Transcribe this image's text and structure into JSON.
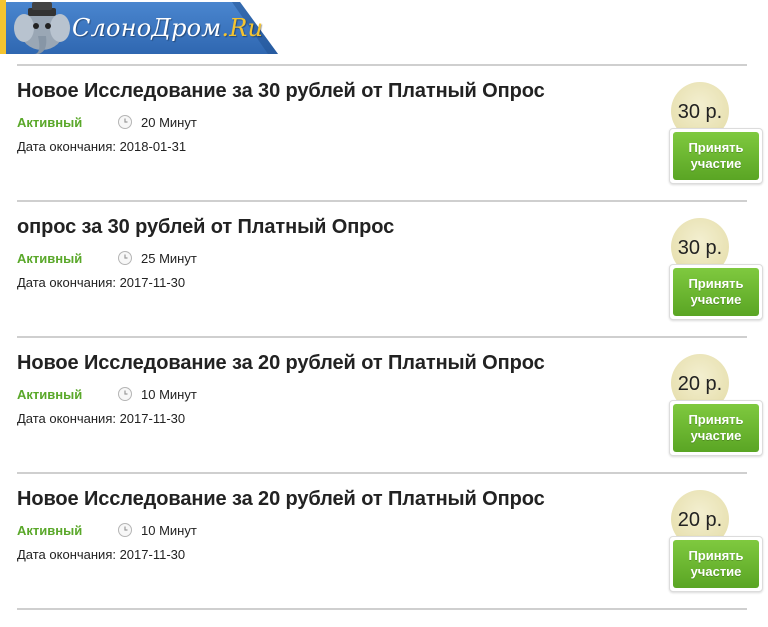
{
  "header": {
    "logo_main": "СлоноДром",
    "logo_suffix": ".Ru"
  },
  "colors": {
    "status_green": "#5aa82a",
    "button_green": "#6bb82f",
    "banner_blue": "#2f67b1",
    "banner_accent_yellow": "#f4c430",
    "badge_beige": "#e8e1b2"
  },
  "icons": {
    "logo": "elephant-mascot-icon",
    "duration": "clock-icon"
  },
  "surveys": [
    {
      "title": "Новое Исследование за 30 рублей от Платный Опрос",
      "status": "Активный",
      "duration": "20 Минут",
      "end_date": "Дата окончания: 2018-01-31",
      "price": "30 р.",
      "button": "Принять участие"
    },
    {
      "title": "опрос за 30 рублей от Платный Опрос",
      "status": "Активный",
      "duration": "25 Минут",
      "end_date": "Дата окончания: 2017-11-30",
      "price": "30 р.",
      "button": "Принять участие"
    },
    {
      "title": "Новое Исследование за 20 рублей от Платный Опрос",
      "status": "Активный",
      "duration": "10 Минут",
      "end_date": "Дата окончания: 2017-11-30",
      "price": "20 р.",
      "button": "Принять участие"
    },
    {
      "title": "Новое Исследование за 20 рублей от Платный Опрос",
      "status": "Активный",
      "duration": "10 Минут",
      "end_date": "Дата окончания: 2017-11-30",
      "price": "20 р.",
      "button": "Принять участие"
    }
  ]
}
